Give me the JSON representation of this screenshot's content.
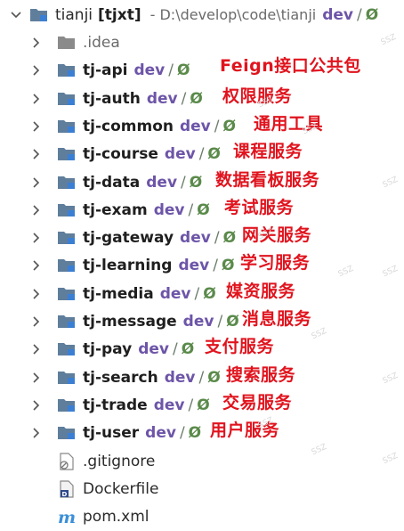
{
  "root": {
    "name": "tianji",
    "module": "[tjxt]",
    "path": "- D:\\develop\\code\\tianji",
    "branch": "dev",
    "slash": "/",
    "status": "Ø"
  },
  "items": [
    {
      "name": ".idea",
      "kind": "idea",
      "branch": "",
      "annotation": ""
    },
    {
      "name": "tj-api",
      "kind": "module",
      "branch": "dev",
      "annotation": "Feign接口公共包"
    },
    {
      "name": "tj-auth",
      "kind": "module",
      "branch": "dev",
      "annotation": "权限服务"
    },
    {
      "name": "tj-common",
      "kind": "module",
      "branch": "dev",
      "annotation": "通用工具"
    },
    {
      "name": "tj-course",
      "kind": "module",
      "branch": "dev",
      "annotation": "课程服务"
    },
    {
      "name": "tj-data",
      "kind": "module",
      "branch": "dev",
      "annotation": "数据看板服务"
    },
    {
      "name": "tj-exam",
      "kind": "module",
      "branch": "dev",
      "annotation": "考试服务"
    },
    {
      "name": "tj-gateway",
      "kind": "module",
      "branch": "dev",
      "annotation": "网关服务"
    },
    {
      "name": "tj-learning",
      "kind": "module",
      "branch": "dev",
      "annotation": "学习服务"
    },
    {
      "name": "tj-media",
      "kind": "module",
      "branch": "dev",
      "annotation": "媒资服务"
    },
    {
      "name": "tj-message",
      "kind": "module",
      "branch": "dev",
      "annotation": "消息服务"
    },
    {
      "name": "tj-pay",
      "kind": "module",
      "branch": "dev",
      "annotation": "支付服务"
    },
    {
      "name": "tj-search",
      "kind": "module",
      "branch": "dev",
      "annotation": "搜索服务"
    },
    {
      "name": "tj-trade",
      "kind": "module",
      "branch": "dev",
      "annotation": "交易服务"
    },
    {
      "name": "tj-user",
      "kind": "module",
      "branch": "dev",
      "annotation": "用户服务"
    }
  ],
  "files": [
    {
      "name": ".gitignore",
      "icon": "gitignore-file-icon"
    },
    {
      "name": "Dockerfile",
      "icon": "dockerfile-icon"
    },
    {
      "name": "pom.xml",
      "icon": "maven-pom-icon"
    }
  ],
  "vcs": {
    "slash": "/",
    "status": "Ø"
  },
  "watermark": "SSZ",
  "colors": {
    "annotation": "#e0141e",
    "branch": "#6d55a8",
    "folder": "#5f7e9c",
    "module_marker": "#3b7fd4"
  }
}
